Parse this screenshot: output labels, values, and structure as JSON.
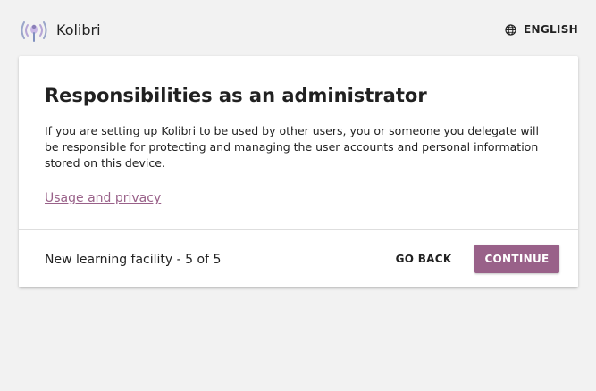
{
  "header": {
    "app_name": "Kolibri",
    "language_label": "ENGLISH",
    "logo_icon": "kolibri-hummingbird-icon",
    "language_icon": "globe-icon"
  },
  "card": {
    "title": "Responsibilities as an administrator",
    "description": "If you are setting up Kolibri to be used by other users, you or someone you delegate will be responsible for protecting and managing the user accounts and personal information stored on this device.",
    "privacy_link": "Usage and privacy"
  },
  "footer": {
    "step_text": "New learning facility - 5 of 5",
    "back_label": "GO BACK",
    "continue_label": "CONTINUE"
  },
  "colors": {
    "brand": "#996189",
    "background": "#f2f2f2",
    "card": "#ffffff"
  }
}
